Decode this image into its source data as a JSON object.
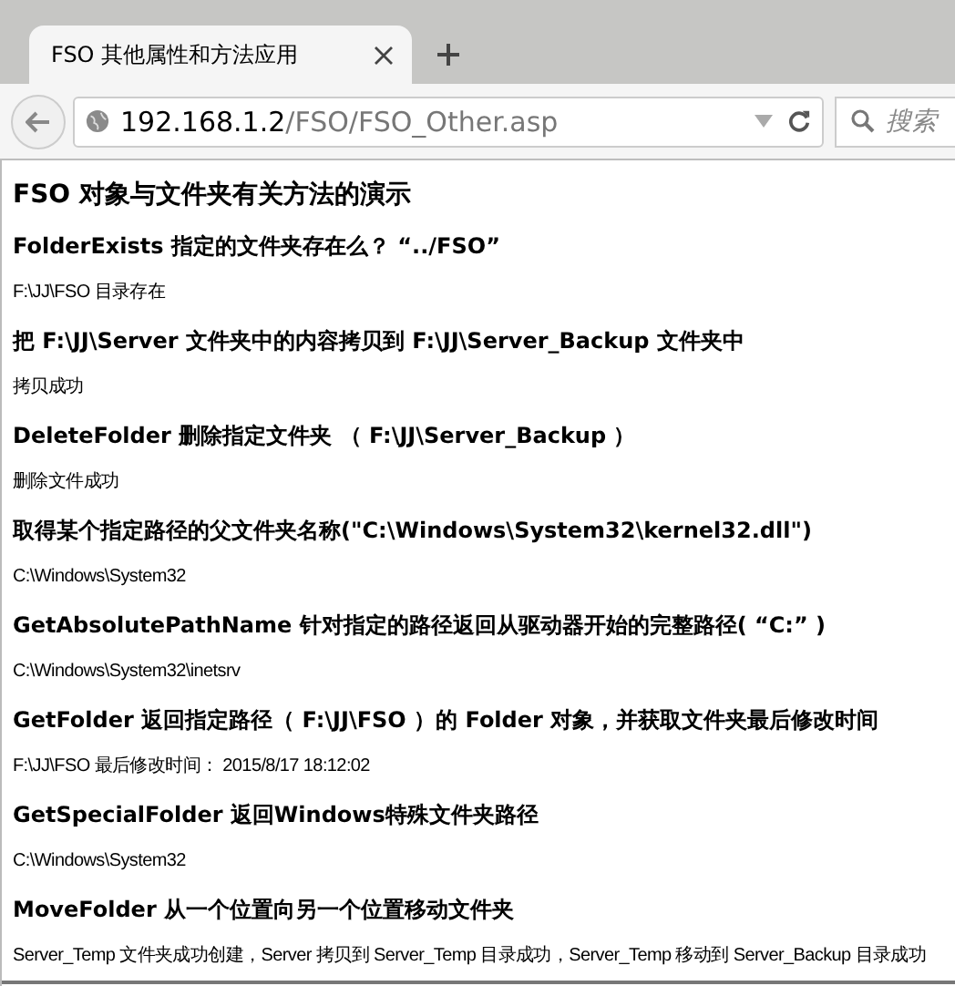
{
  "browser": {
    "tab_title": "FSO 其他属性和方法应用",
    "url_host": "192.168.1.2",
    "url_path": "/FSO/FSO_Other.asp",
    "search": {
      "placeholder": "搜索"
    }
  },
  "page": {
    "heading": "FSO 对象与文件夹有关方法的演示",
    "sections": [
      {
        "title": "FolderExists 指定的文件夹存在么？ “../FSO”",
        "result": "F:\\JJ\\FSO 目录存在"
      },
      {
        "title": "把 F:\\JJ\\Server 文件夹中的内容拷贝到 F:\\JJ\\Server_Backup 文件夹中",
        "result": "拷贝成功"
      },
      {
        "title": "DeleteFolder 删除指定文件夹 （ F:\\JJ\\Server_Backup ）",
        "result": "删除文件成功"
      },
      {
        "title": "取得某个指定路径的父文件夹名称(\"C:\\Windows\\System32\\kernel32.dll\")",
        "result": "C:\\Windows\\System32"
      },
      {
        "title": "GetAbsolutePathName 针对指定的路径返回从驱动器开始的完整路径( “C:” )",
        "result": "C:\\Windows\\System32\\inetsrv"
      },
      {
        "title": "GetFolder 返回指定路径（ F:\\JJ\\FSO ）的 Folder 对象，并获取文件夹最后修改时间",
        "result": "F:\\JJ\\FSO 最后修改时间： 2015/8/17 18:12:02"
      },
      {
        "title": "GetSpecialFolder 返回Windows特殊文件夹路径",
        "result": "C:\\Windows\\System32"
      },
      {
        "title": "MoveFolder 从一个位置向另一个位置移动文件夹",
        "result": "Server_Temp 文件夹成功创建，Server 拷贝到 Server_Temp 目录成功，Server_Temp 移动到 Server_Backup 目录成功"
      }
    ]
  }
}
